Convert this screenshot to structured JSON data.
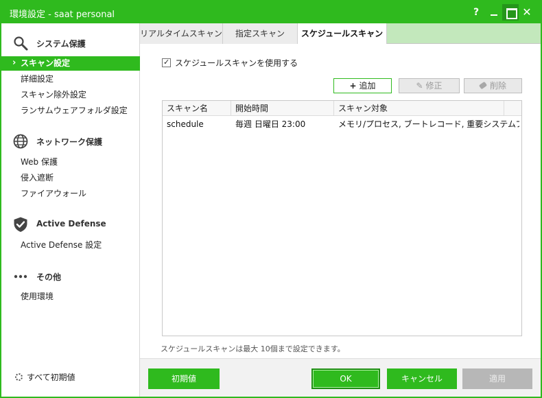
{
  "window": {
    "title": "環境設定 - saat personal",
    "help_glyph": "?",
    "close_glyph": "✕",
    "accent": "#2fba1e"
  },
  "sidebar": {
    "sections": [
      {
        "label": "システム保護",
        "icon": "search-icon",
        "items": [
          {
            "label": "スキャン設定",
            "active": true
          },
          {
            "label": "詳細設定"
          },
          {
            "label": "スキャン除外設定"
          },
          {
            "label": "ランサムウェアフォルダ設定"
          }
        ]
      },
      {
        "label": "ネットワーク保護",
        "icon": "globe-icon",
        "items": [
          {
            "label": "Web 保護"
          },
          {
            "label": "侵入遮断"
          },
          {
            "label": "ファイアウォール"
          }
        ]
      },
      {
        "label": "Active Defense",
        "icon": "shield-check-icon",
        "items": [
          {
            "label": "Active Defense 設定"
          }
        ]
      },
      {
        "label": "その他",
        "icon": "more-dots-icon",
        "items": [
          {
            "label": "使用環境"
          }
        ]
      }
    ],
    "reset_all": "すべて初期値"
  },
  "tabs": [
    {
      "label": "リアルタイムスキャン"
    },
    {
      "label": "指定スキャン"
    },
    {
      "label": "スケジュールスキャン",
      "active": true
    }
  ],
  "main": {
    "use_schedule_label": "スケジュールスキャンを使用する",
    "use_schedule_checked": true,
    "add_label": "追加",
    "edit_label": "修正",
    "delete_label": "削除",
    "columns": [
      "スキャン名",
      "開始時間",
      "スキャン対象"
    ],
    "rows": [
      {
        "name": "schedule",
        "start": "毎週 日曜日 23:00",
        "target": "メモリ/プロセス, ブートレコード, 重要システムファ..."
      }
    ],
    "note": "スケジュールスキャンは最大 10個まで設定できます。"
  },
  "footer": {
    "reset_label": "初期値",
    "ok_label": "OK",
    "cancel_label": "キャンセル",
    "apply_label": "適用"
  }
}
